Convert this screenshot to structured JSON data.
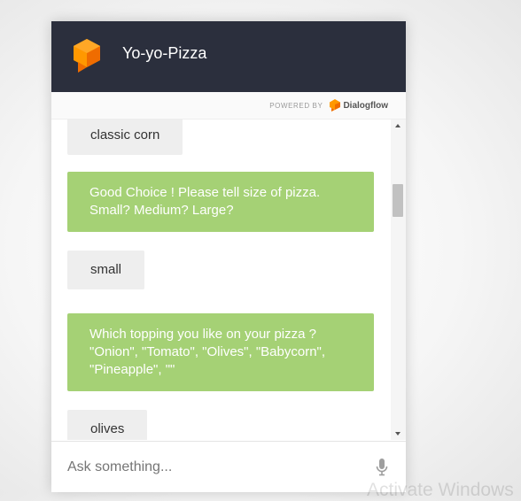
{
  "header": {
    "title": "Yo-yo-Pizza"
  },
  "powered": {
    "label": "POWERED BY",
    "brand": "Dialogflow"
  },
  "messages": [
    {
      "from": "user",
      "text": "classic corn"
    },
    {
      "from": "bot",
      "text": "Good Choice ! Please tell size of pizza. Small? Medium? Large?"
    },
    {
      "from": "user",
      "text": "small"
    },
    {
      "from": "bot",
      "text": "Which topping you like on your pizza ? \"Onion\", \"Tomato\", \"Olives\", \"Babycorn\", \"Pineapple\", \"\""
    },
    {
      "from": "user",
      "text": "olives"
    }
  ],
  "input": {
    "placeholder": "Ask something..."
  },
  "watermark": "Activate Windows",
  "colors": {
    "header": "#2b2f3d",
    "bot_bubble": "#a5d175",
    "user_bubble": "#eeeeee",
    "logo": "#ff9800"
  }
}
